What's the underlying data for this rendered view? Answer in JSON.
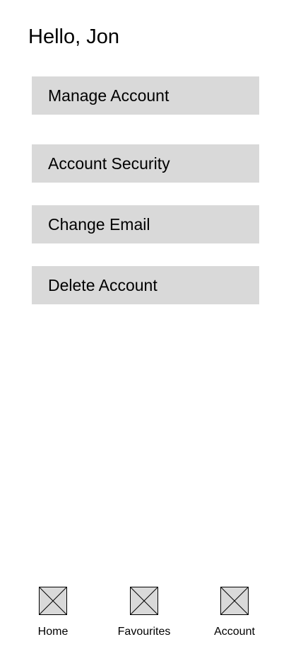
{
  "header": {
    "greeting": "Hello, Jon"
  },
  "menu": {
    "items": [
      {
        "label": "Manage Account"
      },
      {
        "label": "Account Security"
      },
      {
        "label": "Change Email"
      },
      {
        "label": "Delete Account"
      }
    ]
  },
  "bottom_nav": {
    "items": [
      {
        "label": "Home",
        "icon": "image-placeholder-icon"
      },
      {
        "label": "Favourites",
        "icon": "image-placeholder-icon"
      },
      {
        "label": "Account",
        "icon": "image-placeholder-icon"
      }
    ]
  },
  "colors": {
    "button_background": "#d9d9d9",
    "text": "#000000",
    "background": "#ffffff"
  }
}
